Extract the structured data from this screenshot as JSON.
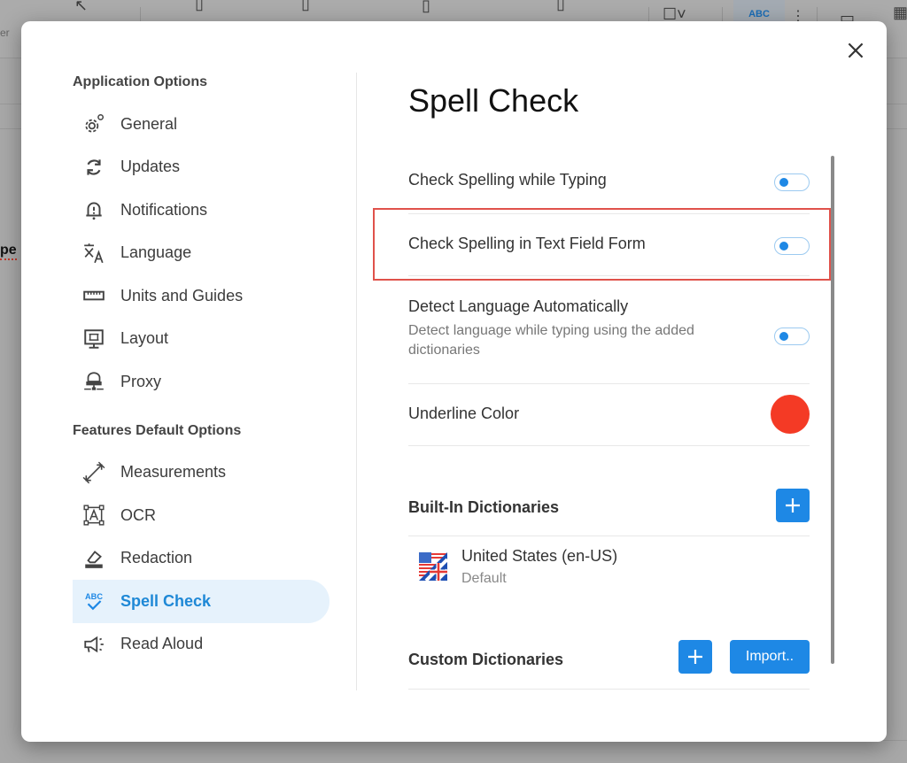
{
  "background": {
    "partial_text": "pe",
    "partial_left_label": "er",
    "toolbar_badge": "ABC"
  },
  "modal": {
    "close_icon": "close-icon",
    "sidebar": {
      "group1_heading": "Application Options",
      "group1_items": [
        {
          "label": "General",
          "icon": "gear-icon"
        },
        {
          "label": "Updates",
          "icon": "sync-icon"
        },
        {
          "label": "Notifications",
          "icon": "bell-alert-icon"
        },
        {
          "label": "Language",
          "icon": "translate-icon"
        },
        {
          "label": "Units and Guides",
          "icon": "ruler-icon"
        },
        {
          "label": "Layout",
          "icon": "monitor-layout-icon"
        },
        {
          "label": "Proxy",
          "icon": "network-drive-icon"
        }
      ],
      "group2_heading": "Features Default Options",
      "group2_items": [
        {
          "label": "Measurements",
          "icon": "measure-arrow-icon"
        },
        {
          "label": "OCR",
          "icon": "ocr-icon"
        },
        {
          "label": "Redaction",
          "icon": "eraser-icon"
        },
        {
          "label": "Spell Check",
          "icon": "spell-check-icon",
          "active": true
        },
        {
          "label": "Read Aloud",
          "icon": "megaphone-icon"
        }
      ]
    },
    "main": {
      "title": "Spell Check",
      "settings": [
        {
          "title": "Check Spelling while Typing",
          "enabled": false
        },
        {
          "title": "Check Spelling in Text Field Form",
          "enabled": false,
          "highlighted": true
        },
        {
          "title": "Detect Language Automatically",
          "description": "Detect language while typing using the added dictionaries",
          "enabled": false
        }
      ],
      "underline_color": {
        "label": "Underline Color",
        "value": "#f43a25"
      },
      "built_in": {
        "title": "Built-In Dictionaries",
        "add_label": "+",
        "items": [
          {
            "name": "United States (en-US)",
            "sub": "Default",
            "icon": "us-uk-flag-icon"
          }
        ]
      },
      "custom": {
        "title": "Custom Dictionaries",
        "add_label": "+",
        "import_label": "Import.."
      }
    }
  },
  "colors": {
    "accent": "#1e88e5",
    "highlight_border": "#e0524b",
    "active_bg": "#e6f2fc"
  }
}
